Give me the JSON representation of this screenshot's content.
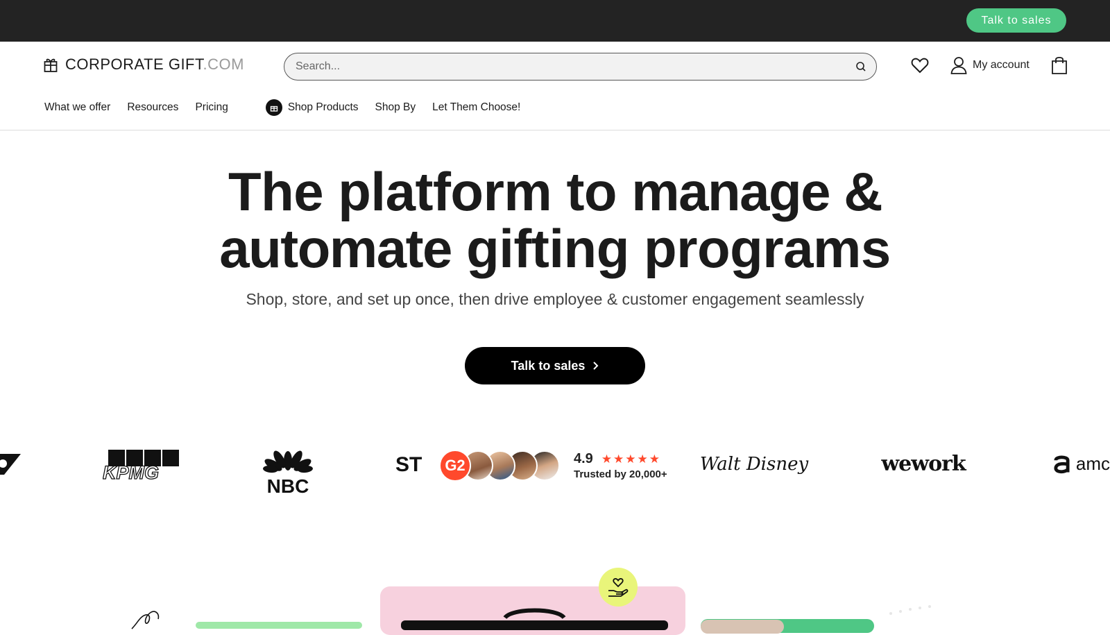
{
  "topbar": {
    "cta_label": "Talk to sales"
  },
  "header": {
    "logo": {
      "main": "CORPORATE GIFT",
      "domain": ".COM"
    },
    "search": {
      "placeholder": "Search..."
    },
    "account_label": "My account"
  },
  "nav": {
    "items": [
      "What we offer",
      "Resources",
      "Pricing"
    ],
    "shop_products": "Shop Products",
    "shop_by": "Shop By",
    "let_them_choose": "Let Them Choose!"
  },
  "hero": {
    "title_part1": "The platform to ",
    "title_bold1": "manage &",
    "title_bold2": "automate",
    "title_part2": " gifting programs",
    "subtitle": "Shop, store, and set up once, then drive employee & customer engagement seamlessly",
    "cta_label": "Talk to sales"
  },
  "logos": {
    "kpmg": "KPMG",
    "nbc": "NBC",
    "partial": "ST",
    "disney": "Walt Disney",
    "wework": "wework",
    "amc": "amc"
  },
  "rating": {
    "g2": "G2",
    "score": "4.9",
    "stars": "★★★★★",
    "trusted": "Trusted by 20,000+"
  },
  "colors": {
    "topbar_bg": "#232323",
    "accent_green": "#4fc785",
    "g2_red": "#ff492c",
    "card_pink": "#f7d1de",
    "badge_lime": "#e9f57a"
  }
}
